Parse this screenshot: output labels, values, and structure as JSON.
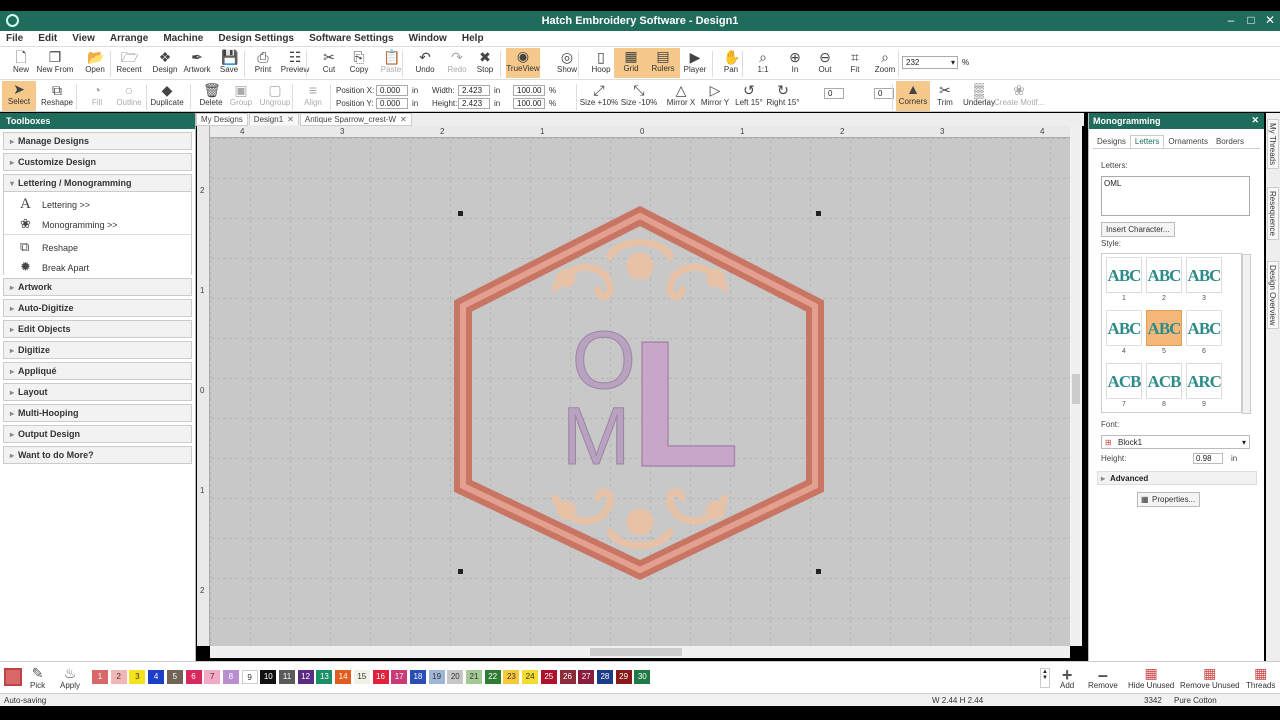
{
  "window": {
    "title": "Hatch Embroidery Software - Design1"
  },
  "menu": [
    "File",
    "Edit",
    "View",
    "Arrange",
    "Machine",
    "Design Settings",
    "Software Settings",
    "Window",
    "Help"
  ],
  "toolbar1": [
    {
      "label": "New",
      "icon": "new-doc-icon"
    },
    {
      "label": "New From",
      "icon": "new-from-icon"
    },
    {
      "label": "Open",
      "icon": "folder-icon"
    },
    {
      "label": "Recent",
      "icon": "recent-icon"
    },
    {
      "label": "Design",
      "icon": "design-icon"
    },
    {
      "label": "Artwork",
      "icon": "artwork-icon"
    },
    {
      "label": "Save",
      "icon": "save-icon"
    },
    {
      "label": "Print",
      "icon": "print-icon"
    },
    {
      "label": "Preview",
      "icon": "preview-icon"
    },
    {
      "label": "Cut",
      "icon": "cut-icon"
    },
    {
      "label": "Copy",
      "icon": "copy-icon"
    },
    {
      "label": "Paste",
      "icon": "paste-icon"
    },
    {
      "label": "Undo",
      "icon": "undo-icon"
    },
    {
      "label": "Redo",
      "icon": "redo-icon"
    },
    {
      "label": "Stop",
      "icon": "stop-icon"
    },
    {
      "label": "TrueView",
      "icon": "trueview-icon"
    },
    {
      "label": "Show",
      "icon": "show-icon"
    },
    {
      "label": "Hoop",
      "icon": "hoop-icon"
    },
    {
      "label": "Grid",
      "icon": "grid-icon"
    },
    {
      "label": "Rulers",
      "icon": "rulers-icon"
    },
    {
      "label": "Player",
      "icon": "player-icon"
    },
    {
      "label": "Pan",
      "icon": "pan-hand-icon"
    },
    {
      "label": "1:1",
      "icon": "zoom-1to1-icon"
    },
    {
      "label": "In",
      "icon": "zoom-in-icon"
    },
    {
      "label": "Out",
      "icon": "zoom-out-icon"
    },
    {
      "label": "Fit",
      "icon": "zoom-fit-icon"
    },
    {
      "label": "Zoom",
      "icon": "zoom-icon"
    }
  ],
  "zoom": {
    "value": "232",
    "unit": "%"
  },
  "toolbar2": [
    {
      "label": "Select",
      "icon": "select-arrow-icon"
    },
    {
      "label": "Reshape",
      "icon": "reshape-icon"
    },
    {
      "label": "Fill",
      "icon": "fill-icon"
    },
    {
      "label": "Outline",
      "icon": "outline-icon"
    },
    {
      "label": "Duplicate",
      "icon": "duplicate-icon"
    },
    {
      "label": "Delete",
      "icon": "delete-icon"
    },
    {
      "label": "Group",
      "icon": "group-icon"
    },
    {
      "label": "Ungroup",
      "icon": "ungroup-icon"
    },
    {
      "label": "Align",
      "icon": "align-icon"
    },
    {
      "label": "Size +10%",
      "icon": "size-plus-icon"
    },
    {
      "label": "Size -10%",
      "icon": "size-minus-icon"
    },
    {
      "label": "Mirror X",
      "icon": "mirror-x-icon"
    },
    {
      "label": "Mirror Y",
      "icon": "mirror-y-icon"
    },
    {
      "label": "Left 15°",
      "icon": "rotate-left-icon"
    },
    {
      "label": "Right 15°",
      "icon": "rotate-right-icon"
    },
    {
      "label": "Corners",
      "icon": "corners-icon"
    },
    {
      "label": "Trim",
      "icon": "trim-icon"
    },
    {
      "label": "Underlay",
      "icon": "underlay-icon"
    },
    {
      "label": "Create Motif...",
      "icon": "motif-icon"
    }
  ],
  "position": {
    "x_label": "Position X:",
    "y_label": "Position Y:",
    "x": "0.000",
    "y": "0.000",
    "unit": "in"
  },
  "size": {
    "w_label": "Width:",
    "h_label": "Height:",
    "w": "2.423",
    "h": "2.423",
    "unit": "in",
    "wp": "100.00",
    "hp": "100.00",
    "punit": "%"
  },
  "rotate": {
    "value": "0",
    "unit": "°"
  },
  "slant": {
    "value": "0",
    "unit": "°"
  },
  "toolboxes": {
    "title": "Toolboxes",
    "sections_top": [
      "Manage Designs",
      "Customize Design"
    ],
    "open_section": "Lettering / Monogramming",
    "open_items": [
      {
        "label": "Lettering >>",
        "icon": "lettering-icon"
      },
      {
        "label": "Monogramming >>",
        "icon": "monogram-icon"
      },
      {
        "label": "Reshape",
        "icon": "reshape-icon"
      },
      {
        "label": "Break Apart",
        "icon": "break-apart-icon"
      }
    ],
    "sections_bottom": [
      "Artwork",
      "Auto-Digitize",
      "Edit Objects",
      "Digitize",
      "Appliqué",
      "Layout",
      "Multi-Hooping",
      "Output Design",
      "Want to do More?"
    ]
  },
  "doc_tabs": [
    "My Designs",
    "Design1",
    "Antique Sparrow_crest-W"
  ],
  "ruler_h": [
    "4",
    "3",
    "2",
    "1",
    "0",
    "1",
    "2",
    "3",
    "4"
  ],
  "ruler_v": [
    "2",
    "1",
    "0",
    "1",
    "2"
  ],
  "design": {
    "monogram": [
      "O",
      "M",
      "L"
    ]
  },
  "monogramming": {
    "title": "Monogramming",
    "tabs": [
      "Designs",
      "Letters",
      "Ornaments",
      "Borders"
    ],
    "letters_label": "Letters:",
    "letters_value": "OML",
    "insert_char": "Insert Character...",
    "style_label": "Style:",
    "styles": [
      {
        "num": "1",
        "glyph": "ABC"
      },
      {
        "num": "2",
        "glyph": "ABC"
      },
      {
        "num": "3",
        "glyph": "ABC"
      },
      {
        "num": "4",
        "glyph": "ABC"
      },
      {
        "num": "5",
        "glyph": "ABC"
      },
      {
        "num": "6",
        "glyph": "ABC"
      },
      {
        "num": "7",
        "glyph": "ACB"
      },
      {
        "num": "8",
        "glyph": "ACB"
      },
      {
        "num": "9",
        "glyph": "ARC"
      }
    ],
    "selected_style": "5",
    "font_label": "Font:",
    "font_value": "Block1",
    "height_label": "Height:",
    "height_value": "0.98",
    "height_unit": "in",
    "advanced": "Advanced",
    "properties": "Properties..."
  },
  "side_tabs": [
    "My Threads",
    "Resequence",
    "Design Overview"
  ],
  "palette": [
    {
      "n": "1",
      "c": "#d9686b"
    },
    {
      "n": "2",
      "c": "#f2b6b5"
    },
    {
      "n": "3",
      "c": "#f4e21c"
    },
    {
      "n": "4",
      "c": "#1c3fc9"
    },
    {
      "n": "5",
      "c": "#726455"
    },
    {
      "n": "6",
      "c": "#d9285d"
    },
    {
      "n": "7",
      "c": "#f4a9c6"
    },
    {
      "n": "8",
      "c": "#b88ed1"
    },
    {
      "n": "9",
      "c": "#ffffff"
    },
    {
      "n": "10",
      "c": "#111111"
    },
    {
      "n": "11",
      "c": "#5a5a5a"
    },
    {
      "n": "12",
      "c": "#5b2b85"
    },
    {
      "n": "13",
      "c": "#1c8f66"
    },
    {
      "n": "14",
      "c": "#e25c1f"
    },
    {
      "n": "15",
      "c": "#f1f1e6"
    },
    {
      "n": "16",
      "c": "#e0223d"
    },
    {
      "n": "17",
      "c": "#c93b78"
    },
    {
      "n": "18",
      "c": "#2a4eb5"
    },
    {
      "n": "19",
      "c": "#9fb6d8"
    },
    {
      "n": "20",
      "c": "#c7c7c7"
    },
    {
      "n": "21",
      "c": "#a4c992"
    },
    {
      "n": "22",
      "c": "#2e7d32"
    },
    {
      "n": "23",
      "c": "#f7c93a"
    },
    {
      "n": "24",
      "c": "#f4dc2f"
    },
    {
      "n": "25",
      "c": "#b0122e"
    },
    {
      "n": "26",
      "c": "#8a2d3a"
    },
    {
      "n": "27",
      "c": "#8a1d3e"
    },
    {
      "n": "28",
      "c": "#1c3d8a"
    },
    {
      "n": "29",
      "c": "#8a1a1a"
    },
    {
      "n": "30",
      "c": "#1e7a47"
    }
  ],
  "bottom_tools": {
    "pick": "Pick",
    "apply": "Apply",
    "add": "Add",
    "remove": "Remove",
    "hide_unused": "Hide Unused",
    "remove_unused": "Remove Unused",
    "threads": "Threads"
  },
  "status": {
    "left": "Auto-saving",
    "dims": "W 2.44 H 2.44",
    "stitches": "3342",
    "thread": "Pure Cotton"
  }
}
